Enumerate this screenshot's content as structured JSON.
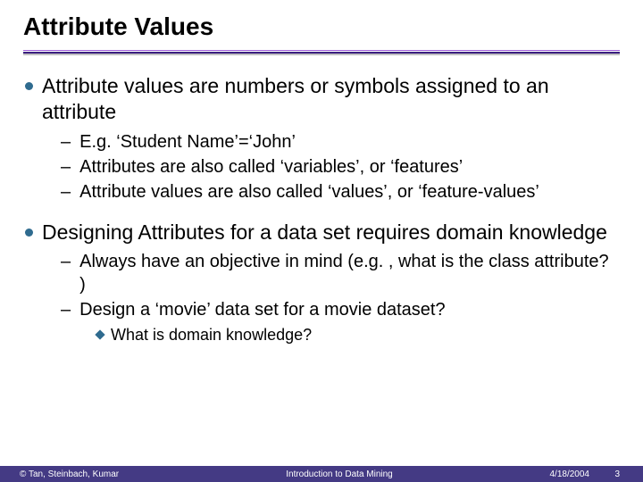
{
  "title": "Attribute Values",
  "bullets": [
    {
      "text": "Attribute values are numbers or symbols assigned to an attribute",
      "sub": [
        {
          "text": "E.g. ‘Student Name’=‘John’"
        },
        {
          "text": "Attributes are also called ‘variables’, or ‘features’"
        },
        {
          "text": "Attribute values are also called ‘values’, or ‘feature-values’"
        }
      ]
    },
    {
      "text": "Designing Attributes for a data set requires domain knowledge",
      "sub": [
        {
          "text": "Always have an objective in mind (e.g. , what is the class attribute? )"
        },
        {
          "text": "Design a ‘movie’ data set for a movie dataset?",
          "sub": [
            {
              "text": "What is domain knowledge?"
            }
          ]
        }
      ]
    }
  ],
  "footer": {
    "left": "© Tan, Steinbach, Kumar",
    "center": "Introduction to Data Mining",
    "date": "4/18/2004",
    "page": "3"
  }
}
